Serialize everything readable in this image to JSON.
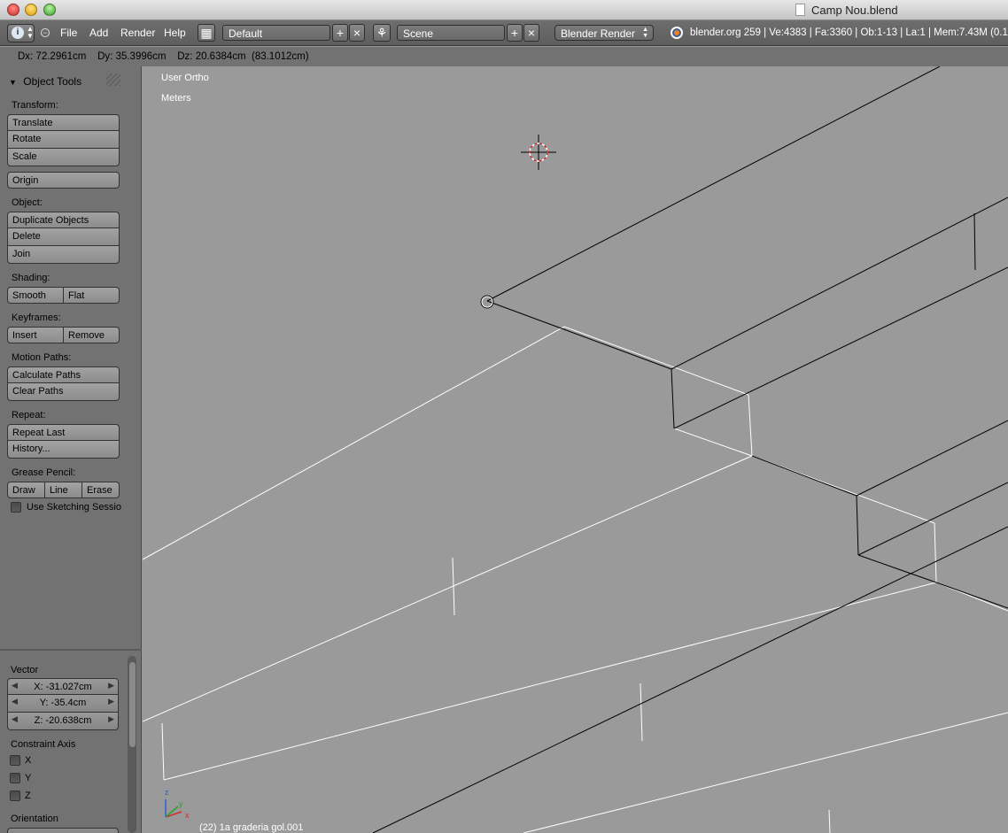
{
  "window": {
    "title": "Camp Nou.blend"
  },
  "header": {
    "menus": [
      "File",
      "Add",
      "Render",
      "Help"
    ],
    "screen_layout": "Default",
    "scene": "Scene",
    "render_engine": "Blender Render",
    "stats": "blender.org 259 | Ve:4383 | Fa:3360 | Ob:1-13 | La:1 | Mem:7.43M (0.1"
  },
  "status": {
    "text": "Dx: 72.2961cm    Dy: 35.3996cm    Dz: 20.6384cm  (83.1012cm)"
  },
  "toolshelf": {
    "title": "Object Tools",
    "transform_label": "Transform:",
    "translate": "Translate",
    "rotate": "Rotate",
    "scale": "Scale",
    "origin": "Origin",
    "object_label": "Object:",
    "duplicate": "Duplicate Objects",
    "delete": "Delete",
    "join": "Join",
    "shading_label": "Shading:",
    "smooth": "Smooth",
    "flat": "Flat",
    "keyframes_label": "Keyframes:",
    "insert": "Insert",
    "remove": "Remove",
    "motion_label": "Motion Paths:",
    "calc_paths": "Calculate Paths",
    "clear_paths": "Clear Paths",
    "repeat_label": "Repeat:",
    "repeat_last": "Repeat Last",
    "history": "History...",
    "grease_label": "Grease Pencil:",
    "draw": "Draw",
    "line": "Line",
    "erase": "Erase",
    "sketching": "Use Sketching Sessio"
  },
  "operator": {
    "vector_label": "Vector",
    "x": "X: -31.027cm",
    "y": "Y: -35.4cm",
    "z": "Z: -20.638cm",
    "constraint_label": "Constraint Axis",
    "cx": "X",
    "cy": "Y",
    "cz": "Z",
    "orientation_label": "Orientation"
  },
  "viewport": {
    "view_name": "User Ortho",
    "units": "Meters",
    "object_info": "(22) 1a graderia gol.001",
    "axis_z": "z",
    "axis_y": "y",
    "axis_x": "x"
  }
}
